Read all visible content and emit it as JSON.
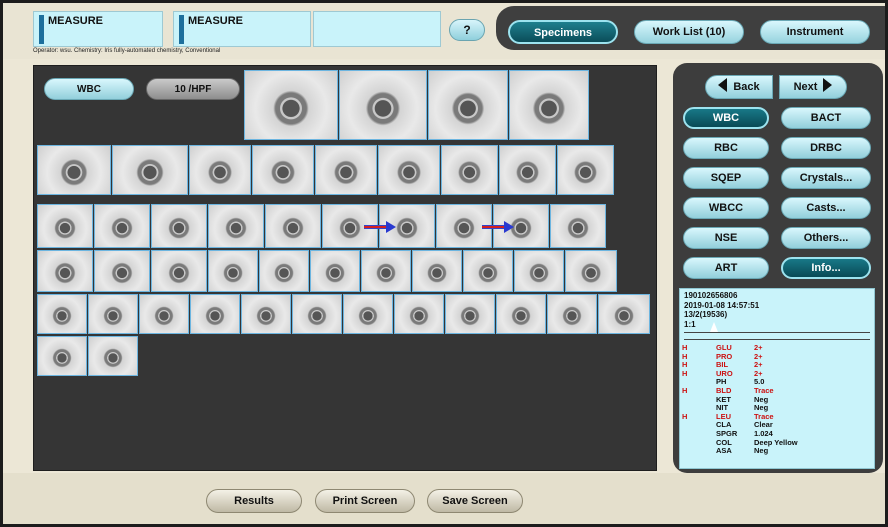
{
  "header": {
    "measure_1": "MEASURE",
    "measure_2": "MEASURE",
    "help_label": "?",
    "operator_line": "Operator: wsu.   Chemistry: Iris fully-automated chemistry, Conventional",
    "nav": [
      {
        "label": "Specimens",
        "active": true
      },
      {
        "label": "Work List (10)",
        "active": false
      },
      {
        "label": "Instrument",
        "active": false
      }
    ]
  },
  "main": {
    "category_label": "WBC",
    "count_label": "10 /HPF",
    "arrow_icon": "red-blue-arrow-right-icon"
  },
  "side": {
    "back_label": "Back",
    "next_label": "Next",
    "categories": [
      {
        "label": "WBC",
        "active": true
      },
      {
        "label": "BACT",
        "active": false
      },
      {
        "label": "RBC",
        "active": false
      },
      {
        "label": "DRBC",
        "active": false
      },
      {
        "label": "SQEP",
        "active": false
      },
      {
        "label": "Crystals...",
        "active": false
      },
      {
        "label": "WBCC",
        "active": false
      },
      {
        "label": "Casts...",
        "active": false
      },
      {
        "label": "NSE",
        "active": false
      },
      {
        "label": "Others...",
        "active": false
      },
      {
        "label": "ART",
        "active": false
      },
      {
        "label": "Info...",
        "active": true
      }
    ]
  },
  "sample": {
    "id": "190102656806",
    "datetime": "2019-01-08 14:57:51",
    "rack": "13/2(19536)",
    "dilution": "1:1"
  },
  "chemistry": [
    {
      "flag": "H",
      "name": "GLU",
      "value": "2+",
      "abnormal": true
    },
    {
      "flag": "H",
      "name": "PRO",
      "value": "2+",
      "abnormal": true
    },
    {
      "flag": "H",
      "name": "BIL",
      "value": "2+",
      "abnormal": true
    },
    {
      "flag": "H",
      "name": "URO",
      "value": "2+",
      "abnormal": true
    },
    {
      "flag": "",
      "name": "PH",
      "value": "5.0",
      "abnormal": false
    },
    {
      "flag": "H",
      "name": "BLD",
      "value": "Trace",
      "abnormal": true
    },
    {
      "flag": "",
      "name": "KET",
      "value": "Neg",
      "abnormal": false
    },
    {
      "flag": "",
      "name": "NIT",
      "value": "Neg",
      "abnormal": false
    },
    {
      "flag": "H",
      "name": "LEU",
      "value": "Trace",
      "abnormal": true
    },
    {
      "flag": "",
      "name": "CLA",
      "value": "Clear",
      "abnormal": false
    },
    {
      "flag": "",
      "name": "SPGR",
      "value": "1.024",
      "abnormal": false
    },
    {
      "flag": "",
      "name": "COL",
      "value": "Deep Yellow",
      "abnormal": false
    },
    {
      "flag": "",
      "name": "ASA",
      "value": "Neg",
      "abnormal": false
    }
  ],
  "footer": {
    "results_label": "Results",
    "print_label": "Print Screen",
    "save_label": "Save Screen"
  },
  "colors": {
    "accent_cyan": "#c9f3fa",
    "active_teal": "#0b4d59",
    "abnormal_red": "#cc1111"
  }
}
